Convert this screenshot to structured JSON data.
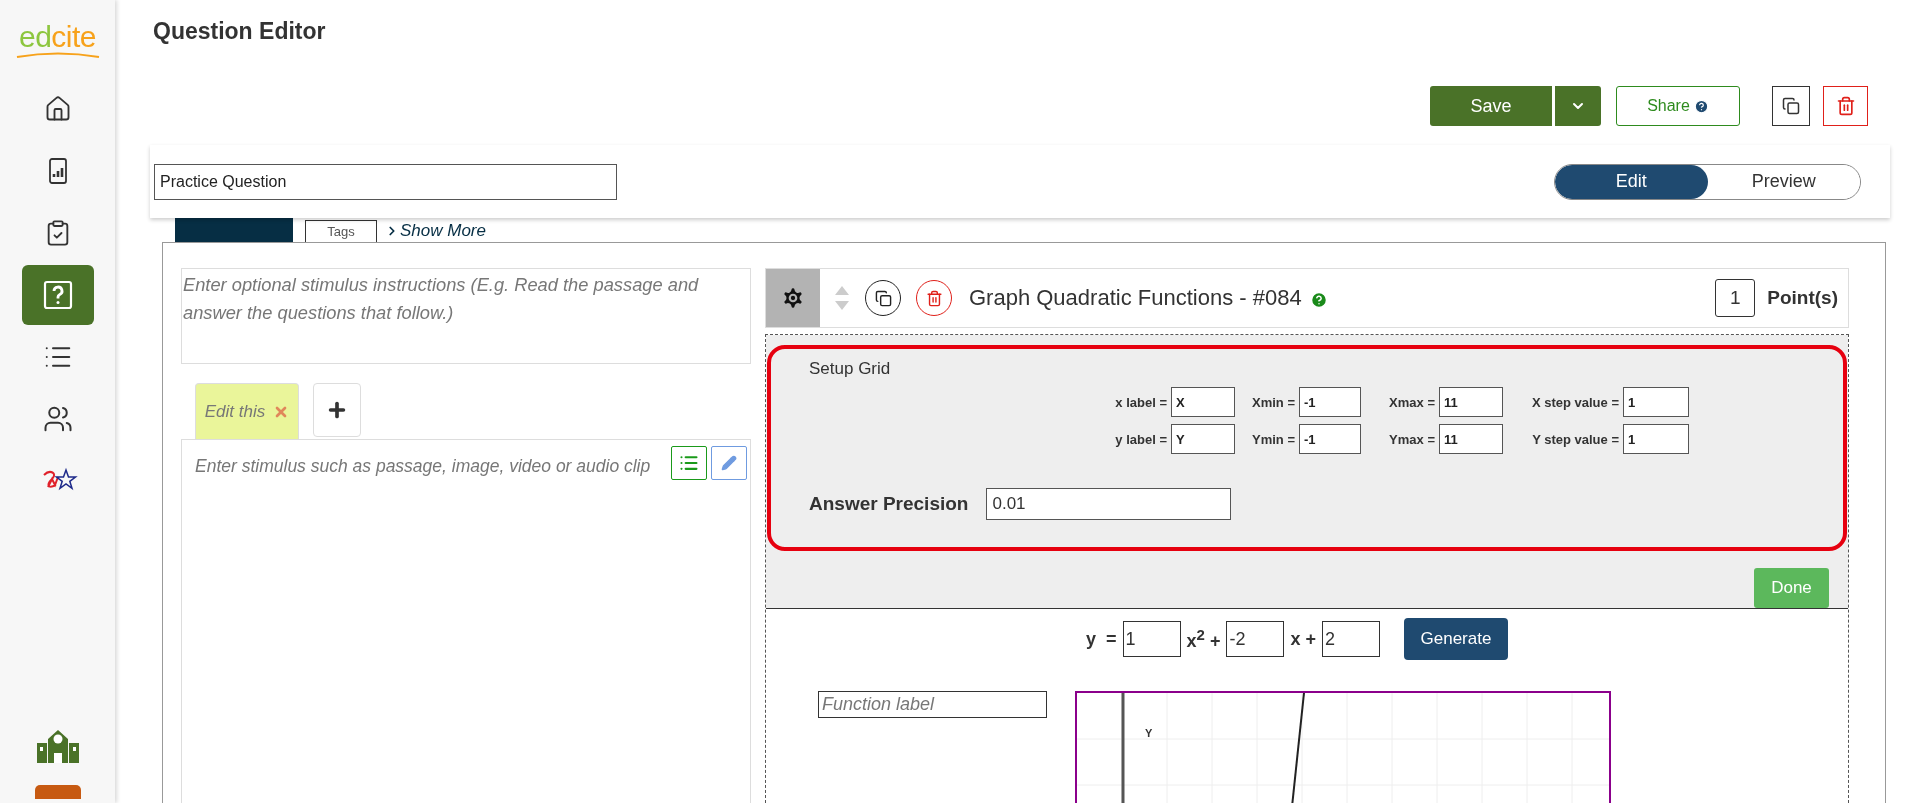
{
  "sidebar": {
    "logo": [
      {
        "text": "ed",
        "color": "#8dc63f"
      },
      {
        "text": "cite",
        "color": "#f7a21b"
      }
    ],
    "items": [
      {
        "kind": "home",
        "selected": false
      },
      {
        "kind": "reports",
        "selected": false
      },
      {
        "kind": "assignments",
        "selected": false
      },
      {
        "kind": "questions",
        "selected": true
      },
      {
        "kind": "list",
        "selected": false
      },
      {
        "kind": "people",
        "selected": false
      },
      {
        "kind": "sw",
        "selected": false
      }
    ],
    "bottom_items": [
      {
        "kind": "school"
      },
      {
        "kind": "badge"
      }
    ]
  },
  "page_title": "Question Editor",
  "toolbar": {
    "save": "Save",
    "share": "Share"
  },
  "question_name": {
    "value": "Practice Question"
  },
  "mode_tabs": [
    {
      "label": "Edit",
      "selected": true
    },
    {
      "label": "Preview",
      "selected": false
    }
  ],
  "behind_bar": {
    "tab": "Tags",
    "link": "Show More"
  },
  "stimulus": {
    "instructions_placeholder": "Enter optional stimulus instructions (E.g. Read the passage and answer the questions that follow.)",
    "tabs": [
      {
        "label": "Edit this",
        "selected": true
      }
    ],
    "body_placeholder": "Enter stimulus such as passage, image, video or audio clip"
  },
  "question": {
    "title": "Graph Quadratic Functions - #084",
    "points": "1",
    "points_label": "Point(s)"
  },
  "setup_grid": {
    "title": "Setup Grid",
    "rows": [
      [
        {
          "label": "x label =",
          "value": "X"
        },
        {
          "label": "Xmin =",
          "value": "-1"
        },
        {
          "label": "Xmax =",
          "value": "11"
        },
        {
          "label": "X step value =",
          "value": "1"
        }
      ],
      [
        {
          "label": "y label =",
          "value": "Y"
        },
        {
          "label": "Ymin =",
          "value": "-1"
        },
        {
          "label": "Ymax =",
          "value": "11"
        },
        {
          "label": "Y step value =",
          "value": "1"
        }
      ]
    ],
    "precision_label": "Answer Precision",
    "precision_value": "0.01",
    "done": "Done"
  },
  "equation": {
    "y": "y  =",
    "a": "1",
    "x2": "x$^{2}$ +",
    "b": "-2",
    "x": "x +",
    "c": "2",
    "generate": "Generate"
  },
  "function_label_placeholder": "Function label",
  "graph": {
    "y_axis_label": "Y"
  }
}
